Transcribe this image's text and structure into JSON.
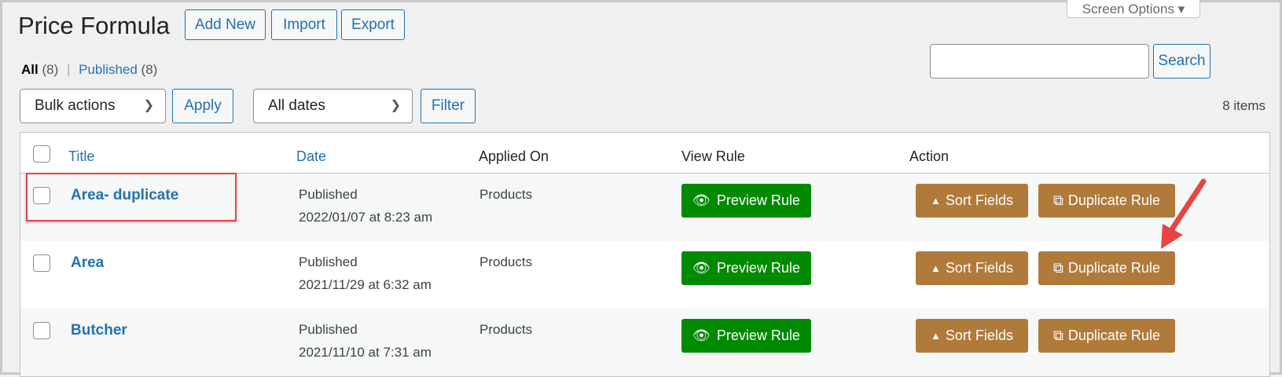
{
  "header": {
    "title": "Price Formula",
    "add_new": "Add New",
    "import": "Import",
    "export": "Export",
    "screen_options": "Screen Options"
  },
  "views": {
    "all": "All",
    "all_count": "(8)",
    "sep": "|",
    "published": "Published",
    "published_count": "(8)"
  },
  "search": {
    "value": "",
    "button": "Search"
  },
  "filters": {
    "bulk_actions": "Bulk actions",
    "apply": "Apply",
    "dates": "All dates",
    "filter": "Filter",
    "items_count": "8 items"
  },
  "columns": {
    "title": "Title",
    "date": "Date",
    "applied_on": "Applied On",
    "view_rule": "View Rule",
    "action": "Action"
  },
  "rows": [
    {
      "title": "Area- duplicate",
      "status": "Published",
      "date": "2022/01/07 at 8:23 am",
      "applied_on": "Products",
      "preview": "Preview Rule",
      "sort": "Sort Fields",
      "duplicate": "Duplicate Rule"
    },
    {
      "title": "Area",
      "status": "Published",
      "date": "2021/11/29 at 6:32 am",
      "applied_on": "Products",
      "preview": "Preview Rule",
      "sort": "Sort Fields",
      "duplicate": "Duplicate Rule"
    },
    {
      "title": "Butcher",
      "status": "Published",
      "date": "2021/11/10 at 7:31 am",
      "applied_on": "Products",
      "preview": "Preview Rule",
      "sort": "Sort Fields",
      "duplicate": "Duplicate Rule"
    }
  ],
  "colors": {
    "link": "#2271b1",
    "preview": "#008a00",
    "action": "#b07a3b",
    "highlight": "#e04848"
  }
}
